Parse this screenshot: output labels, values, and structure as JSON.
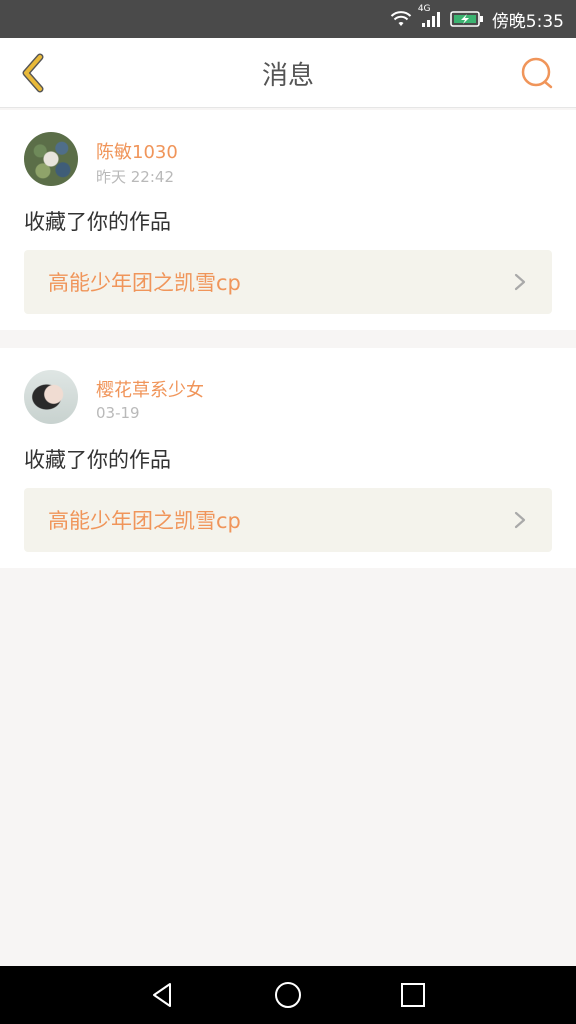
{
  "status_bar": {
    "network_label": "4G",
    "time": "傍晚5:35"
  },
  "header": {
    "title": "消息",
    "back_icon": "chevron-left-icon",
    "search_icon": "search-icon"
  },
  "colors": {
    "accent": "#f0955a",
    "back_icon": "#e8a93a",
    "link_bg": "#f4f3ec",
    "page_bg": "#f7f5f4"
  },
  "messages": [
    {
      "username": "陈敏1030",
      "timestamp": "昨天 22:42",
      "action": "收藏了你的作品",
      "work_title": "高能少年团之凯雪cp"
    },
    {
      "username": "樱花草系少女",
      "timestamp": "03-19",
      "action": "收藏了你的作品",
      "work_title": "高能少年团之凯雪cp"
    }
  ]
}
